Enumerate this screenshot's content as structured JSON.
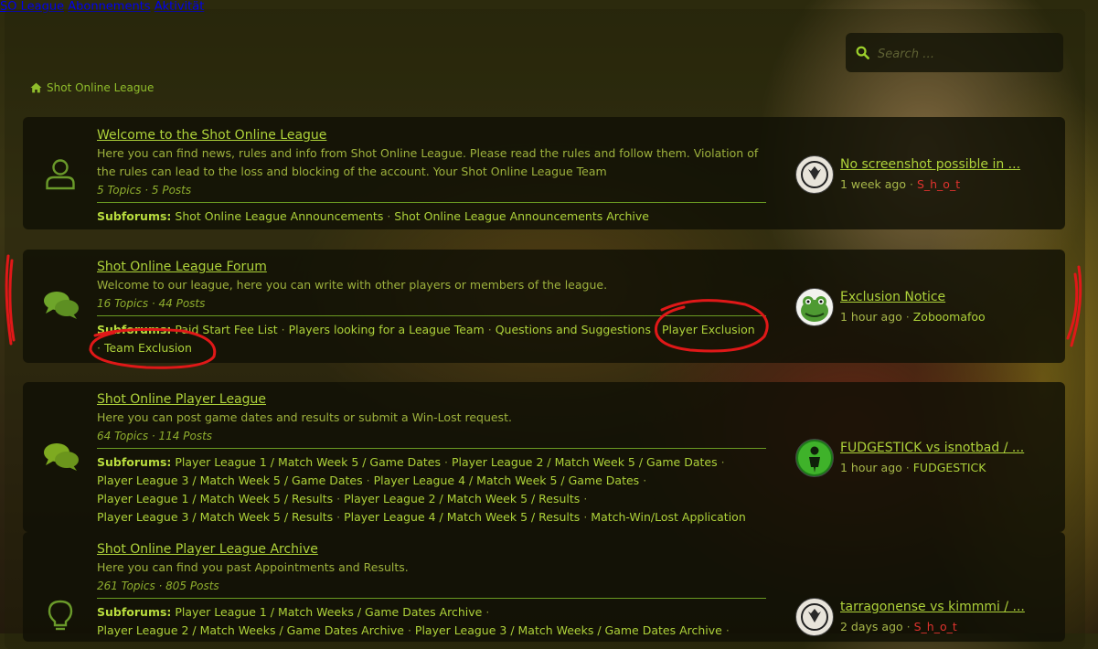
{
  "nav": {
    "items": [
      "SO League",
      "Abonnements",
      "Aktivität"
    ]
  },
  "search": {
    "placeholder": "Search …"
  },
  "breadcrumb": {
    "label": "Shot Online League"
  },
  "forums": [
    {
      "title": "Welcome to the Shot Online League",
      "desc": "Here you can find news, rules and info from Shot Online League. Please read the rules and follow them. Violation of the rules can lead to the loss and blocking of the account. Your Shot Online League Team",
      "stats": "5 Topics · 5 Posts",
      "subforums_label": "Subforums:",
      "subforums": [
        "Shot Online League Announcements",
        "Shot Online League Announcements Archive"
      ],
      "icon": "user-icon",
      "last": {
        "title": "No screenshot possible in ...",
        "time": "1 week ago",
        "user": "S_h_o_t"
      }
    },
    {
      "title": "Shot Online League Forum",
      "desc": "Welcome to our league, here you can write with other players or members of the league.",
      "stats": "16 Topics · 44 Posts",
      "subforums_label": "Subforums:",
      "subforums": [
        "Paid Start Fee List",
        "Players looking for a League Team",
        "Questions and Suggestions",
        "Player Exclusion",
        "Team Exclusion"
      ],
      "icon": "comments-icon",
      "last": {
        "title": "Exclusion Notice",
        "time": "1 hour ago",
        "user": "Zoboomafoo"
      }
    },
    {
      "title": "Shot Online Player League",
      "desc": "Here you can post game dates and results or submit a Win-Lost request.",
      "stats": "64 Topics · 114 Posts",
      "subforums_label": "Subforums:",
      "subforums": [
        "Player League 1 / Match Week 5 / Game Dates",
        "Player League 2 / Match Week 5 / Game Dates",
        "Player League 3 / Match Week 5 / Game Dates",
        "Player League 4 / Match Week 5 / Game Dates",
        "Player League 1 / Match Week 5 / Results",
        "Player League 2 / Match Week 5 / Results",
        "Player League 3 / Match Week 5 / Results",
        "Player League 4 / Match Week 5 / Results",
        "Match-Win/Lost Application"
      ],
      "icon": "comments-icon",
      "last": {
        "title": "FUDGESTICK vs isnotbad / ...",
        "time": "1 hour ago",
        "user": "FUDGESTICK"
      }
    },
    {
      "title": "Shot Online Player League Archive",
      "desc": "Here you can find you past Appointments and Results.",
      "stats": "261 Topics · 805 Posts",
      "subforums_label": "Subforums:",
      "subforums": [
        "Player League 1 / Match Weeks / Game Dates Archive",
        "Player League 2 / Match Weeks / Game Dates Archive",
        "Player League 3 / Match Weeks / Game Dates Archive"
      ],
      "icon": "lightbulb-icon",
      "last": {
        "title": "tarragonense vs kimmmi / ...",
        "time": "2 days ago",
        "user": "S_h_o_t"
      }
    }
  ],
  "colors": {
    "accent": "#aed23a",
    "red_user": "#e0332e",
    "annotation": "#e01818"
  }
}
